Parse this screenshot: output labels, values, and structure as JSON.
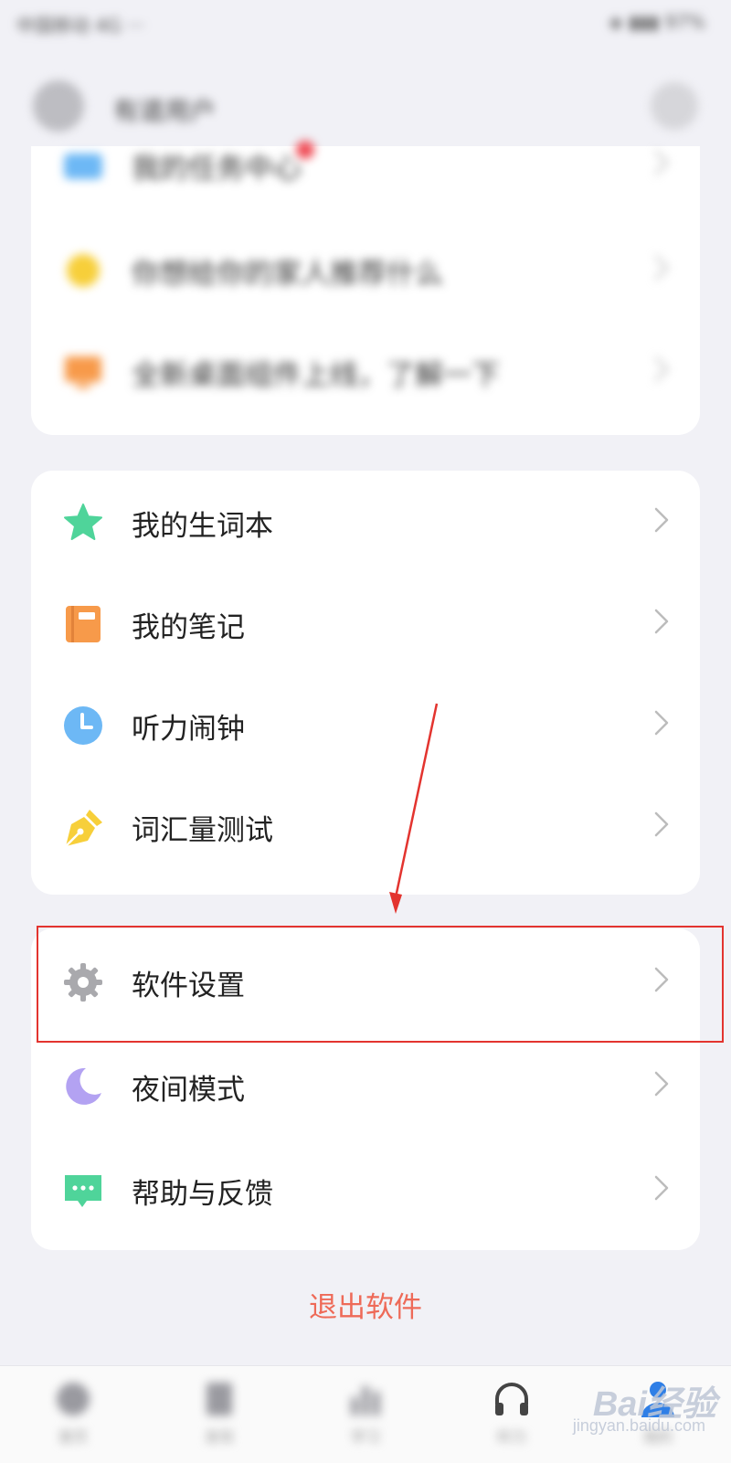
{
  "status_bar": {
    "left": "中国移动 4G  ···",
    "right": "◈ ▮▮▮ 97%"
  },
  "header": {
    "name": "有道用户"
  },
  "top_card": {
    "rows": [
      {
        "label": "我的任务中心"
      },
      {
        "label": "你想给你的家人推荐什么"
      },
      {
        "label": "全新桌面组件上线，了解一下"
      }
    ]
  },
  "tools_card": {
    "rows": [
      {
        "label": "我的生词本",
        "icon": "star-icon"
      },
      {
        "label": "我的笔记",
        "icon": "notebook-icon"
      },
      {
        "label": "听力闹钟",
        "icon": "clock-icon"
      },
      {
        "label": "词汇量测试",
        "icon": "pen-nib-icon"
      }
    ]
  },
  "settings_card": {
    "rows": [
      {
        "label": "软件设置",
        "icon": "gear-icon"
      },
      {
        "label": "夜间模式",
        "icon": "moon-icon"
      },
      {
        "label": "帮助与反馈",
        "icon": "chat-icon"
      }
    ]
  },
  "exit_label": "退出软件",
  "bottom_nav": {
    "tabs": [
      {
        "label": "首页"
      },
      {
        "label": "发现"
      },
      {
        "label": "学习"
      },
      {
        "label": "听力"
      },
      {
        "label": "我的"
      }
    ]
  },
  "watermark": {
    "brand": "Bai经验",
    "url": "jingyan.baidu.com"
  },
  "colors": {
    "background": "#f1f1f6",
    "card": "#ffffff",
    "exit_text": "#ee6a58",
    "highlight_box": "#e3342f",
    "star": "#4fd49a",
    "notebook": "#f79a4a",
    "clock": "#6db8f5",
    "pen": "#f7cf3a",
    "gear": "#a9a9ad",
    "moon": "#b3a2f2",
    "chat": "#4fd49a"
  }
}
